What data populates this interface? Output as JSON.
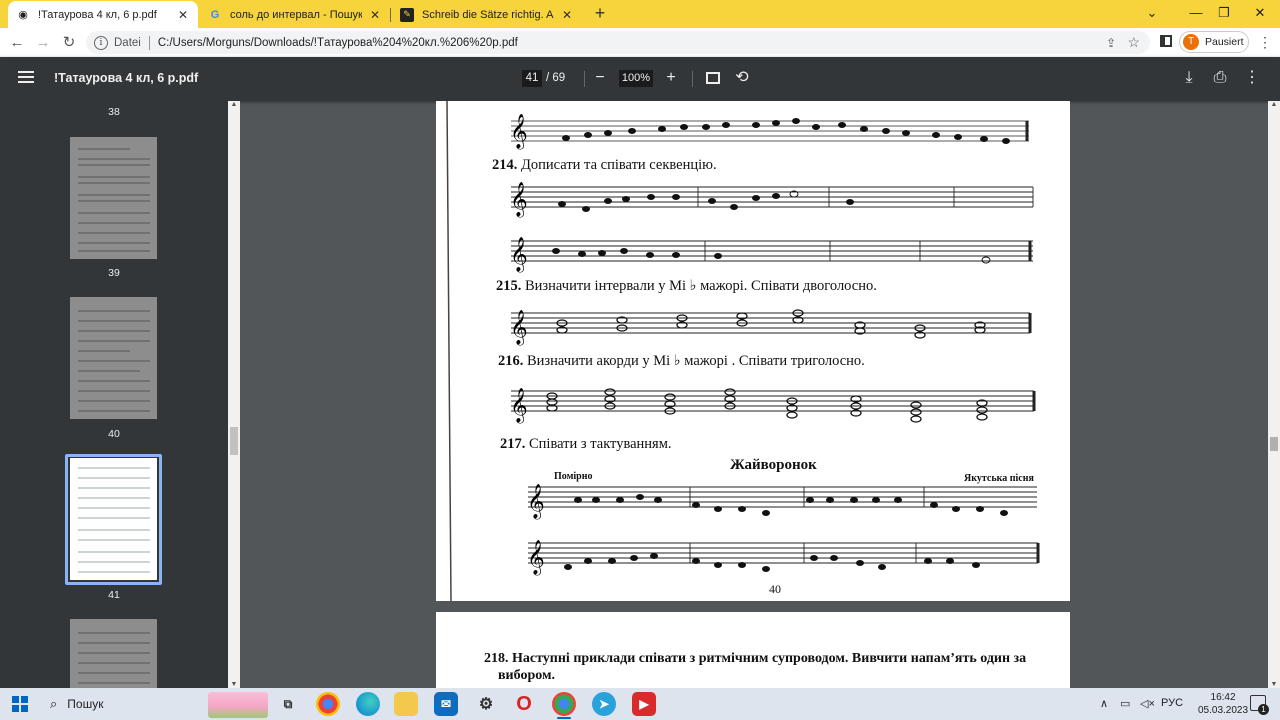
{
  "tabs": [
    {
      "title": "!Татаурова 4 кл, 6 р.pdf",
      "icon": "globe-icon"
    },
    {
      "title": "соль до интервал - Пошук Goo",
      "icon": "google-icon"
    },
    {
      "title": "Schreib die Sätze richtig. Achte a",
      "icon": "bookmark-icon"
    }
  ],
  "address": {
    "scheme_label": "Datei",
    "url": "C:/Users/Morguns/Downloads/!Tатаурова%204%20кл.%206%20р.pdf"
  },
  "profile": {
    "initial": "T",
    "label": "Pausiert"
  },
  "viewer": {
    "title": "!Татаурова 4 кл, 6 р.pdf",
    "current_page": "41",
    "total_pages": "/ 69",
    "zoom": "100%"
  },
  "thumbnails": [
    "38",
    "39",
    "40",
    "41"
  ],
  "page": {
    "ex214": {
      "num": "214.",
      "text": "Дописати та співати секвенцію."
    },
    "ex215": {
      "num": "215.",
      "text": "Визначити інтервали у Мі ♭ мажорі. Співати двоголосно."
    },
    "ex216": {
      "num": "216.",
      "text": "Визначити акорди у Мі ♭ мажорі . Співати триголосно."
    },
    "ex217": {
      "num": "217.",
      "text": "Співати з тактуванням."
    },
    "song_title": "Жайворонок",
    "tempo": "Помірно",
    "source": "Якутська пісня",
    "page_number": "40"
  },
  "next_page": {
    "ex218_num": "218.",
    "ex218_line1": "Наступні приклади співати з ритмічним супроводом. Вивчити напам’ять один за",
    "ex218_line2": "вибором."
  },
  "taskbar": {
    "search_label": "Пошук",
    "lang": "РУС",
    "time": "16:42",
    "date": "05.03.2023",
    "notifications": "1"
  }
}
